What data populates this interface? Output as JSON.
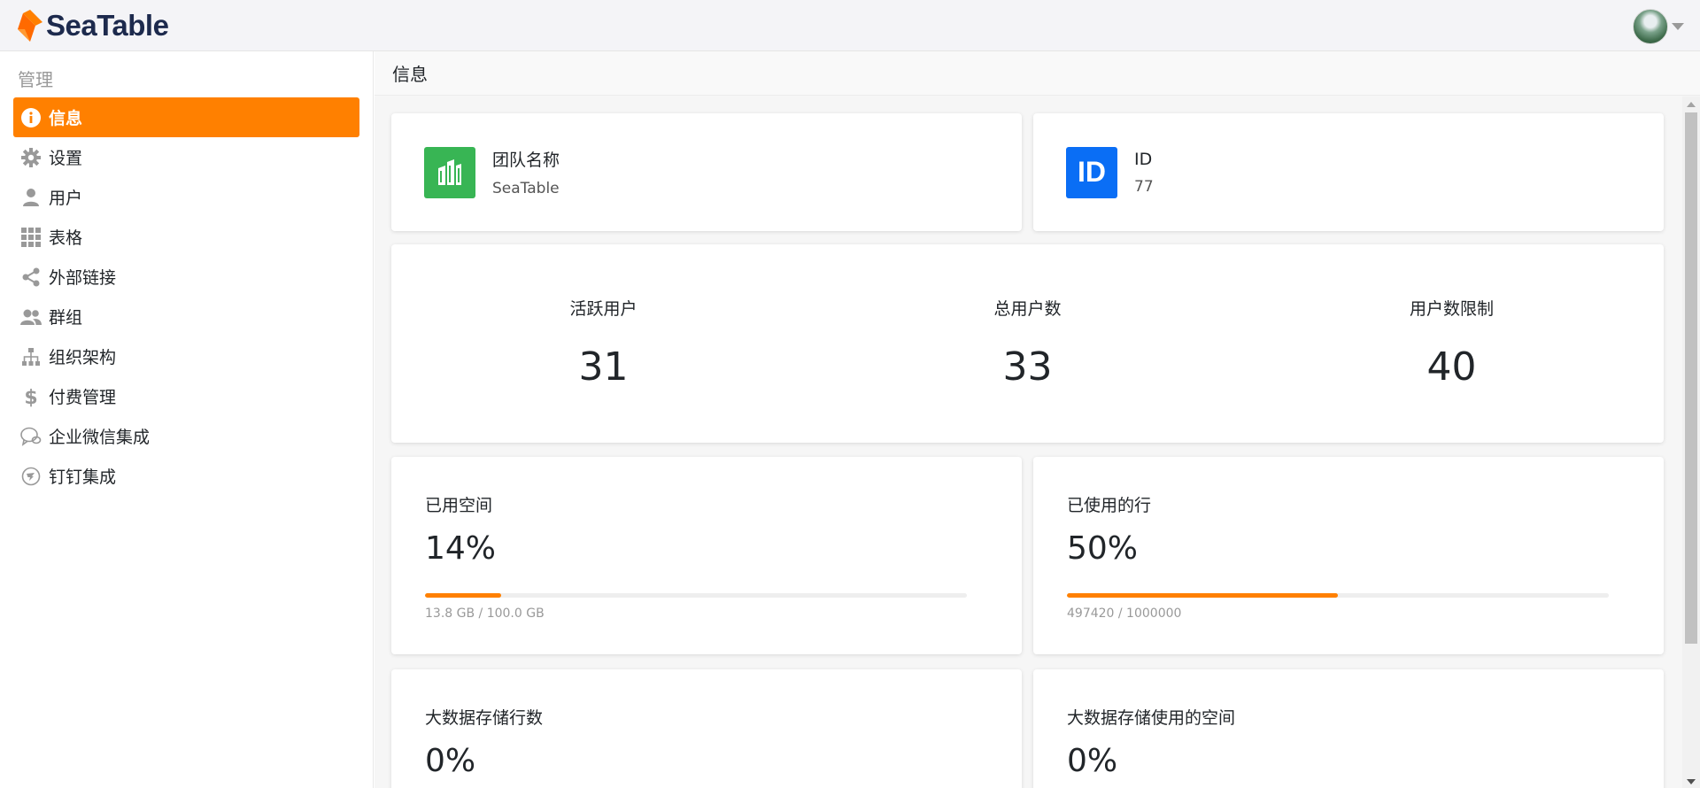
{
  "header": {
    "logo_text": "SeaTable",
    "brand_color": "#ff8000",
    "logo_dark_color": "#1d2a4d"
  },
  "sidebar": {
    "heading": "管理",
    "items": [
      {
        "label": "信息",
        "icon": "info-icon",
        "active": true
      },
      {
        "label": "设置",
        "icon": "gear-icon",
        "active": false
      },
      {
        "label": "用户",
        "icon": "user-icon",
        "active": false
      },
      {
        "label": "表格",
        "icon": "grid-icon",
        "active": false
      },
      {
        "label": "外部链接",
        "icon": "share-icon",
        "active": false
      },
      {
        "label": "群组",
        "icon": "group-icon",
        "active": false
      },
      {
        "label": "组织架构",
        "icon": "org-chart-icon",
        "active": false
      },
      {
        "label": "付费管理",
        "icon": "dollar-icon",
        "active": false
      },
      {
        "label": "企业微信集成",
        "icon": "wechat-icon",
        "active": false
      },
      {
        "label": "钉钉集成",
        "icon": "dingtalk-icon",
        "active": false
      }
    ]
  },
  "main": {
    "title": "信息",
    "team": {
      "label": "团队名称",
      "value": "SeaTable",
      "icon": "building-icon",
      "icon_color": "#38b554"
    },
    "id": {
      "label": "ID",
      "value": "77",
      "icon_text": "ID",
      "icon_color": "#0a6ef5"
    },
    "stats": [
      {
        "label": "活跃用户",
        "value": "31"
      },
      {
        "label": "总用户数",
        "value": "33"
      },
      {
        "label": "用户数限制",
        "value": "40"
      }
    ],
    "usage": [
      {
        "label": "已用空间",
        "value": "14%",
        "fraction": 0.14,
        "caption": "13.8 GB / 100.0 GB"
      },
      {
        "label": "已使用的行",
        "value": "50%",
        "fraction": 0.5,
        "caption": "497420 / 1000000"
      },
      {
        "label": "大数据存储行数",
        "value": "0%"
      },
      {
        "label": "大数据存储使用的空间",
        "value": "0%"
      }
    ]
  }
}
